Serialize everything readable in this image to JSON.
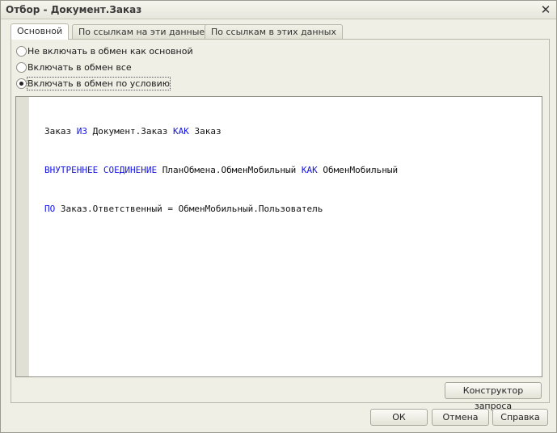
{
  "window": {
    "title": "Отбор - Документ.Заказ"
  },
  "tabs": [
    {
      "label": "Основной",
      "active": true
    },
    {
      "label": "По ссылкам на эти данные",
      "active": false
    },
    {
      "label": "По ссылкам в этих данных",
      "active": false
    }
  ],
  "radios": [
    {
      "label": "Не включать в обмен как основной",
      "checked": false
    },
    {
      "label": "Включать в обмен все",
      "checked": false
    },
    {
      "label": "Включать в обмен по условию",
      "checked": true
    }
  ],
  "query": {
    "line1": {
      "a": "Заказ ",
      "b": "ИЗ",
      "c": " Документ.Заказ ",
      "d": "КАК",
      "e": " Заказ"
    },
    "line2": {
      "a": "ВНУТРЕННЕЕ СОЕДИНЕНИЕ",
      "b": " ПланОбмена.ОбменМобильный ",
      "c": "КАК",
      "d": " ОбменМобильный"
    },
    "line3": {
      "a": "ПО",
      "b": " Заказ.Ответственный = ОбменМобильный.Пользователь"
    }
  },
  "buttons": {
    "constructor": "Конструктор запроса",
    "ok": "ОК",
    "cancel": "Отмена",
    "help": "Справка"
  },
  "colors": {
    "keyword": "#1515e0",
    "text": "#111111"
  }
}
